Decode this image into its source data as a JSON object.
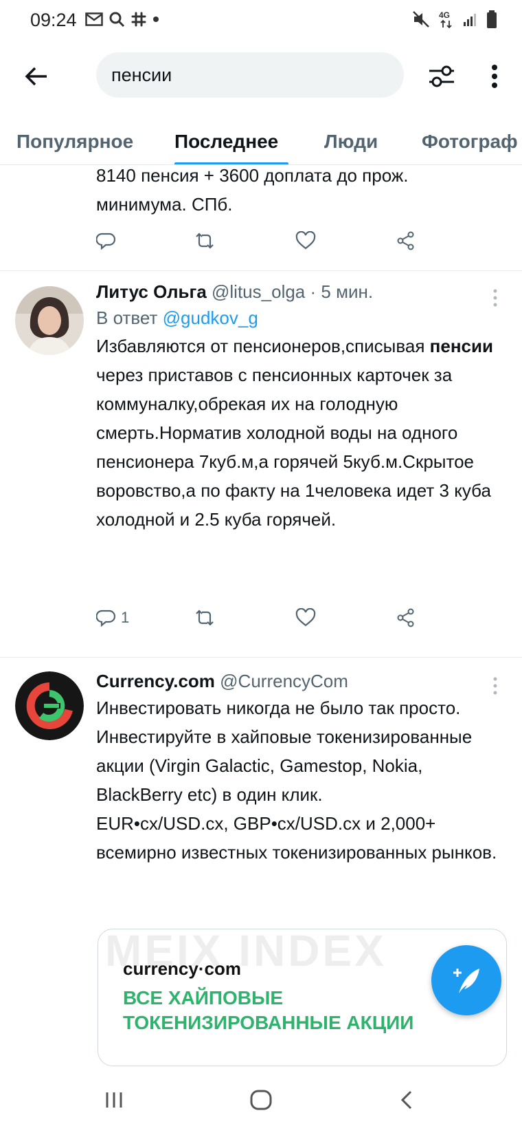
{
  "status_bar": {
    "time": "09:24",
    "left_icons": [
      "mail-icon",
      "search-icon",
      "slack-icon",
      "dot-icon"
    ],
    "right_icons": [
      "mute-icon",
      "network-4g-icon",
      "signal-icon",
      "battery-icon"
    ],
    "network_label": "4G"
  },
  "search": {
    "query": "пенсии"
  },
  "tabs": [
    {
      "label": "Популярное",
      "active": false
    },
    {
      "label": "Последнее",
      "active": true
    },
    {
      "label": "Люди",
      "active": false
    },
    {
      "label": "Фотограф",
      "active": false
    }
  ],
  "partial_tweet": {
    "text_line1": "8140 пенсия + 3600 доплата до прож.",
    "text_line2": "минимума. СПб."
  },
  "tweets": [
    {
      "author": "Литус Ольга",
      "handle": "@litus_olga",
      "separator": "·",
      "time": "5 мин.",
      "reply_prefix": "В ответ",
      "reply_handle": "@gudkov_g",
      "text_before": "Избавляются от пенсионеров,списывая",
      "text_bold": "пенсии",
      "text_after": "через приставов с пенсионных карточек за коммуналку,обрекая их на голодную смерть.Норматив холодной воды на одного пенсионера 7куб.м,а горячей 5куб.м.Скрытое воровство,а по факту на 1человека идет 3 куба холодной и 2.5 куба горячей.",
      "reply_count": "1"
    },
    {
      "author": "Currency.com",
      "handle": "@CurrencyCom",
      "text": "Инвестировать никогда не было так просто.\nИнвестируйте в хайповые токенизированные акции (Virgin Galactic, Gamestop, Nokia, BlackBerry etc) в один клик.\nEUR•cx/USD.cx, GBP•cx/USD.cx и 2,000+ всемирно известных токенизированных рынков.",
      "card": {
        "watermark": "MEIX INDEX",
        "brand": "currency·com",
        "headline_line1": "ВСЕ ХАЙПОВЫЕ",
        "headline_line2": "ТОКЕНИЗИРОВАННЫЕ АКЦИИ"
      }
    }
  ],
  "colors": {
    "accent": "#1d9bf0",
    "secondary_text": "#536471",
    "ad_green": "#2db36b",
    "currency_logo_red": "#e8463b",
    "currency_logo_green": "#3ec46d"
  }
}
